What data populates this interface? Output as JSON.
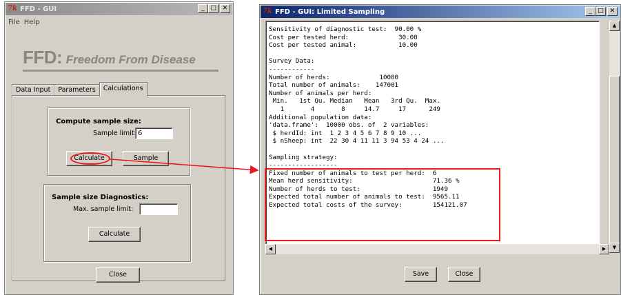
{
  "left_window": {
    "title": "FFD - GUI",
    "menu": [
      "File",
      "Help"
    ],
    "logo_main": "FFD:",
    "logo_sub": "Freedom From Disease",
    "tabs": [
      {
        "label": "Data Input",
        "selected": false
      },
      {
        "label": "Parameters",
        "selected": false
      },
      {
        "label": "Calculations",
        "selected": true
      }
    ],
    "compute": {
      "title": "Compute sample size:",
      "sample_limit_label": "Sample limit:",
      "sample_limit_value": "6",
      "calculate_label": "Calculate",
      "sample_label": "Sample"
    },
    "diagnostics": {
      "title": "Sample size Diagnostics:",
      "max_limit_label": "Max. sample limit:",
      "max_limit_value": "",
      "calculate_label": "Calculate"
    },
    "close_label": "Close"
  },
  "right_window": {
    "title": "FFD - GUI: Limited Sampling",
    "output_lines": [
      "Sensitivity of diagnostic test:  90.00 %",
      "Cost per tested herd:             30.00",
      "Cost per tested animal:           10.00",
      "",
      "Survey Data:",
      "------------",
      "Number of herds:             10000",
      "Total number of animals:    147001",
      "Number of animals per herd:",
      " Min.   1st Qu. Median   Mean   3rd Qu.  Max.",
      "   1       4       8     14.7     17      249",
      "Additional population data:",
      "'data.frame':  10000 obs. of  2 variables:",
      " $ herdId: int  1 2 3 4 5 6 7 8 9 10 ...",
      " $ nSheep: int  22 30 4 11 11 3 94 53 4 24 ...",
      "",
      "Sampling strategy:",
      "------------------",
      "Fixed number of animals to test per herd:  6",
      "Mean herd sensitivity:                     71.36 %",
      "Number of herds to test:                   1949",
      "Expected total number of animals to test:  9565.11",
      "Expected total costs of the survey:        154121.07"
    ],
    "save_label": "Save",
    "close_label": "Close"
  },
  "colors": {
    "annotation": "#e8191c",
    "active_title": "#0a246a",
    "inactive_title": "#8c8c8c",
    "window_face": "#d4d0c8"
  }
}
